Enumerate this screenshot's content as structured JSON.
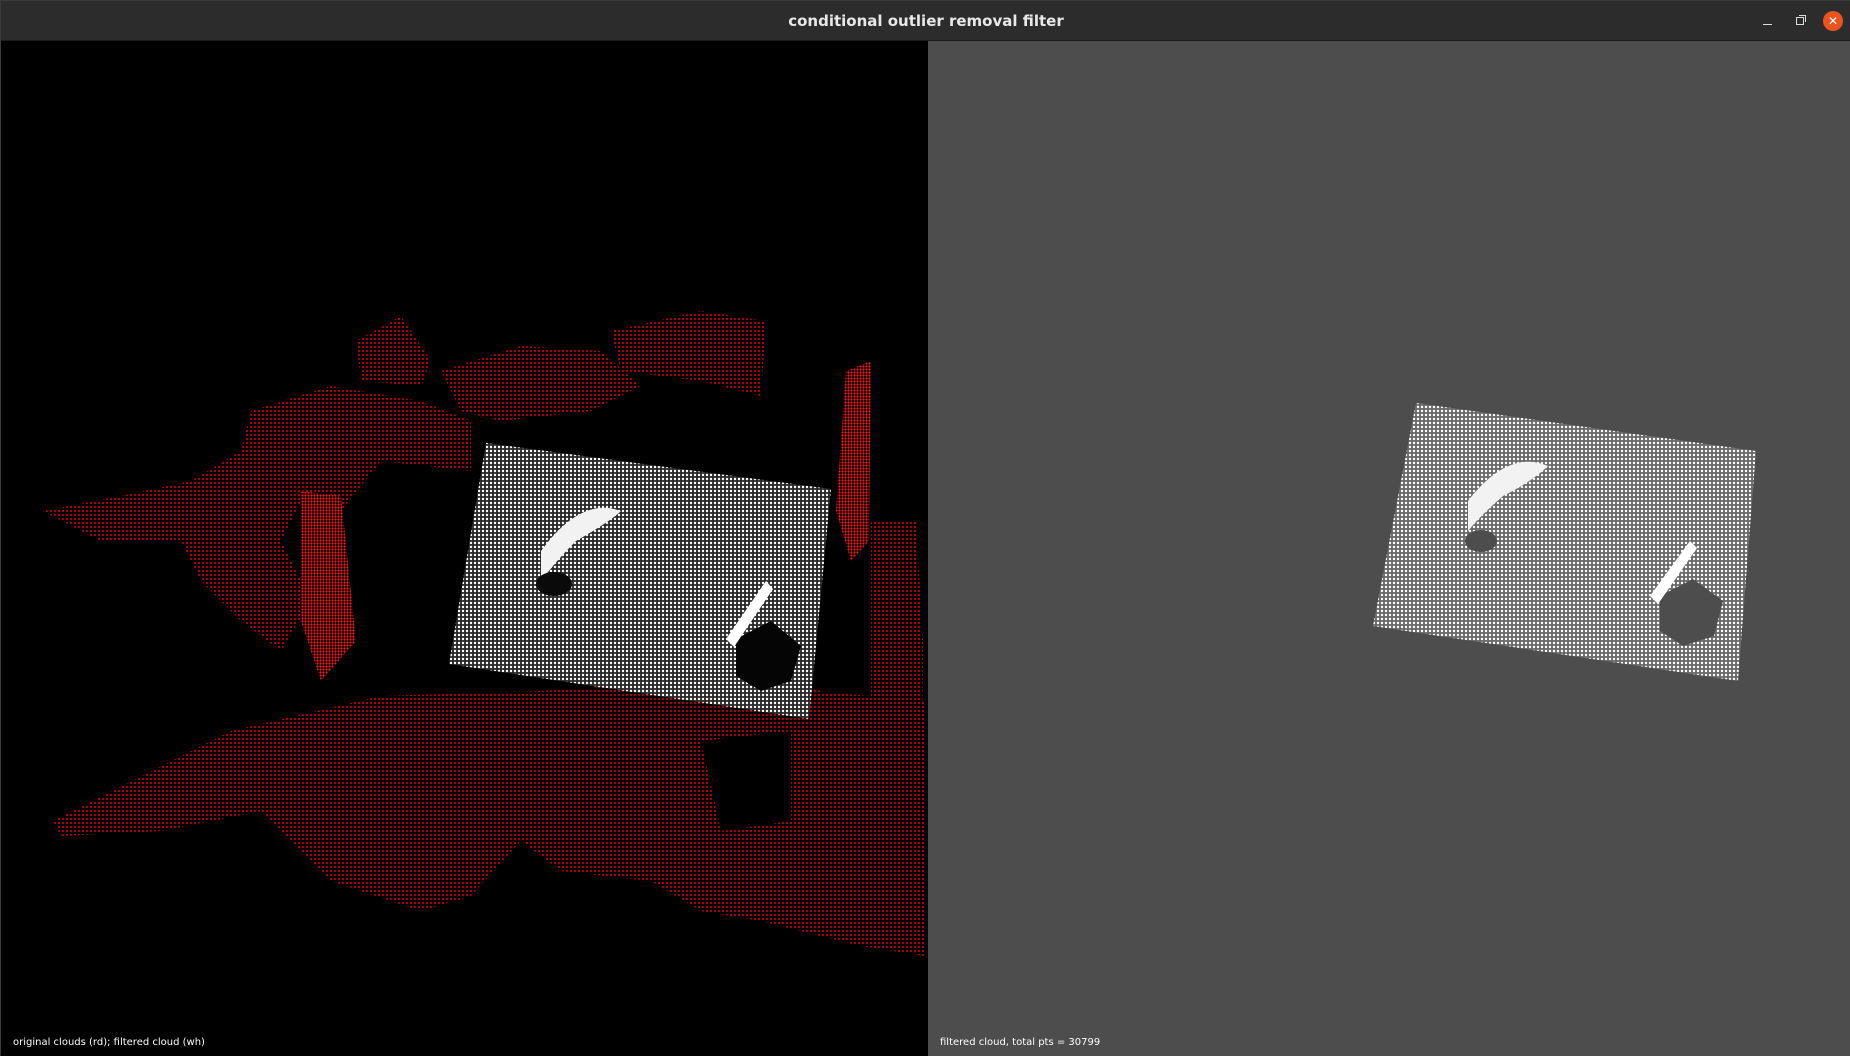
{
  "window": {
    "title": "conditional outlier removal filter"
  },
  "viewports": {
    "left": {
      "label": "original clouds (rd); filtered cloud (wh)",
      "background": "#000000",
      "original_cloud_color": "#ff0000",
      "filtered_cloud_color": "#ffffff"
    },
    "right": {
      "label": "filtered cloud, total pts = 30799",
      "background": "#4d4d4d",
      "filtered_cloud_color": "#ffffff"
    }
  },
  "icons": {
    "minimize": "minimize-icon",
    "maximize": "maximize-icon",
    "close": "close-icon"
  }
}
